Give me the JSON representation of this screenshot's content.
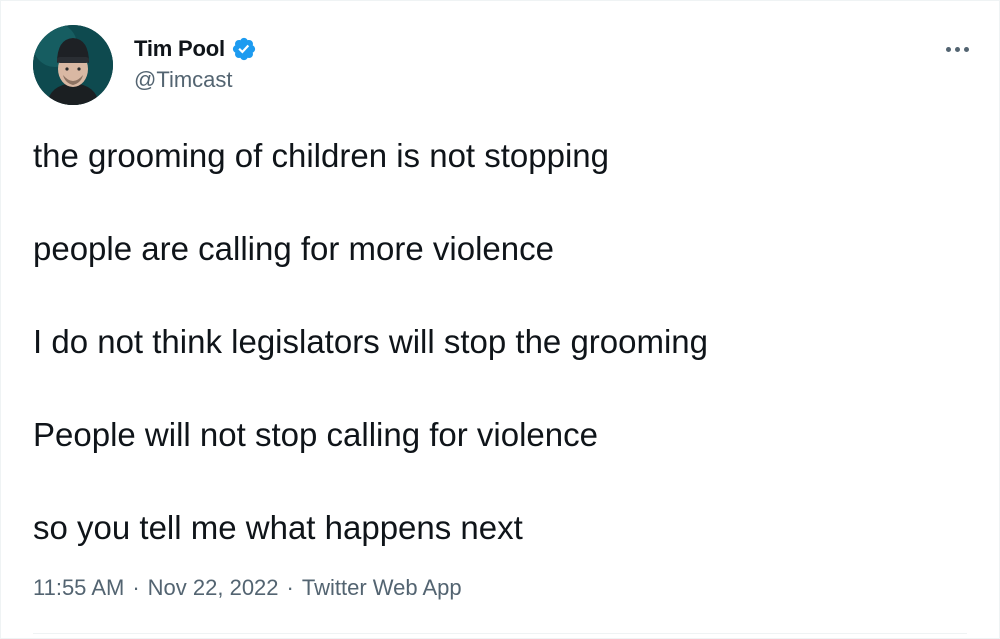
{
  "author": {
    "display_name": "Tim Pool",
    "handle": "@Timcast",
    "verified": true,
    "verified_color": "#1d9bf0"
  },
  "tweet": {
    "lines": [
      "the grooming of children is not stopping",
      "people are calling for more violence",
      "I do not think legislators will stop the grooming",
      "People will not stop calling for violence",
      "so you tell me what happens next"
    ]
  },
  "meta": {
    "time": "11:55 AM",
    "separator": "·",
    "date": "Nov 22, 2022",
    "source": "Twitter Web App"
  },
  "icons": {
    "more": "more-horizontal-icon",
    "verified": "verified-badge-icon"
  }
}
